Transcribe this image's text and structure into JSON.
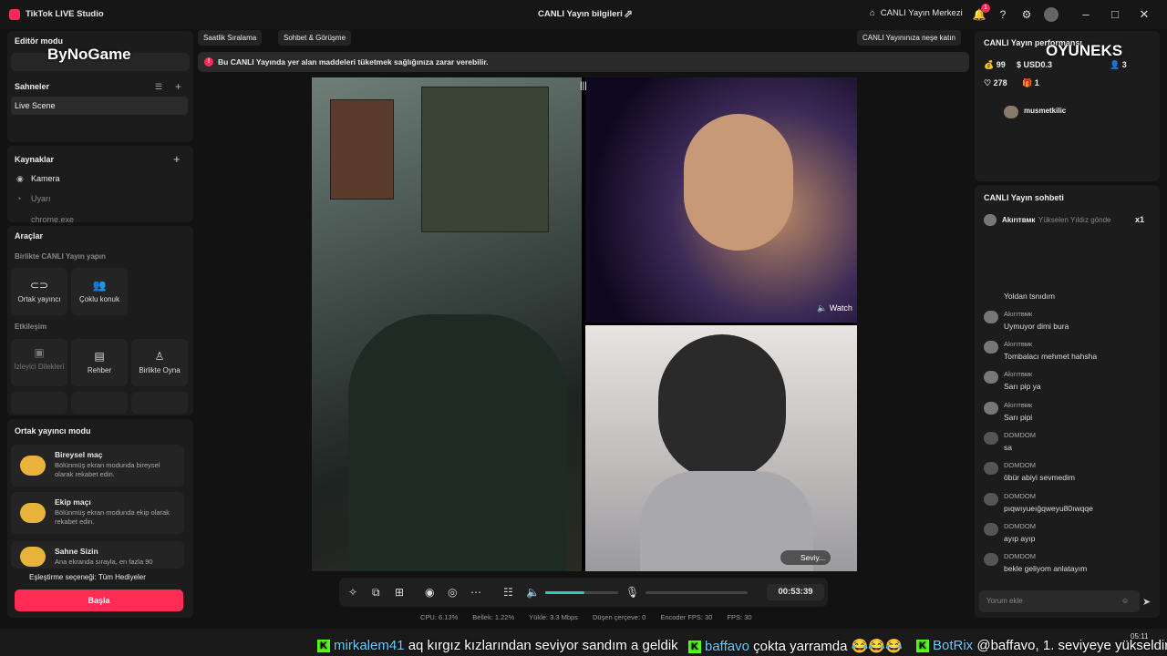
{
  "titlebar": {
    "app_title": "TikTok LIVE Studio",
    "center_title": "CANLI Yayın bilgileri",
    "live_center": "CANLI Yayın Merkezi",
    "notif_count": "1"
  },
  "left": {
    "editor_mode": "Editör modu",
    "watermark": "ByNoGame",
    "scenes_title": "Sahneler",
    "scene_item": "Live Scene",
    "sources_title": "Kaynaklar",
    "sources": [
      "Kamera",
      "Uyarı",
      "chrome.exe"
    ],
    "tools_title": "Araçlar",
    "tools_sub": "Birlikte CANLI Yayın yapın",
    "tool_cards": [
      "Ortak yayıncı",
      "Çoklu konuk"
    ],
    "engagement_title": "Etkileşim",
    "engagement_cards": [
      "İzleyici Dilekleri",
      "Rehber",
      "Birlikte Oyna"
    ],
    "cohost_title": "Ortak yayıncı modu",
    "modes": [
      {
        "title": "Bireysel maç",
        "desc": "Bölünmüş ekran modunda bireysel olarak rekabet edin."
      },
      {
        "title": "Ekip maçı",
        "desc": "Bölünmüş ekran modunda ekip olarak rekabet edin."
      },
      {
        "title": "Sahne Sizin",
        "desc": "Ana ekranda sırayla, en fazla 90"
      }
    ],
    "match_option": "Eşleştirme seçeneği: Tüm Hediyeler",
    "start_button": "Başla"
  },
  "top_chips": {
    "hourly": "Saatlik Sıralama",
    "chat": "Sohbet & Görüşme",
    "join": "CANLI Yayınınıza neşe katın"
  },
  "warning": "Bu CANLI Yayında yer alan maddeleri tüketmek sağlığınıza zarar verebilir.",
  "video": {
    "watch_label": "Watch",
    "guest_label": "Seviy..."
  },
  "controls": {
    "timer": "00:53:39",
    "volume_level": 0.54
  },
  "stats": {
    "cpu": "CPU: 6.13%",
    "memory": "Bellek: 1.22%",
    "upload": "Yükle: 3.3 Mbps",
    "dropped": "Düşen çerçeve: 0",
    "encoder_fps": "Encoder FPS: 30",
    "fps": "FPS: 30"
  },
  "right": {
    "perf_title": "CANLI Yayın performansı",
    "coins": "99",
    "usd": "USD0.3",
    "viewers": "3",
    "likes": "278",
    "gifts": "1",
    "brand_watermark": "OYUNEKS",
    "top_viewer": "musmetkilic",
    "chat_title": "CANLI Yayın sohbeti",
    "gift_line": {
      "name": "Akırıтвмк",
      "text": "Yükselen Yıldız gönde",
      "count": "x1"
    },
    "messages": [
      {
        "name": "",
        "text": "Yoldan tsnıdım"
      },
      {
        "name": "Akırıтвмк",
        "text": "Uymuyor dimi bura"
      },
      {
        "name": "Akırıтвмк",
        "text": "Tombalacı mehmet hahsha"
      },
      {
        "name": "Akırıтвмк",
        "text": "Sarı pip ya"
      },
      {
        "name": "Akırıтвмк",
        "text": "Sarı pipi"
      },
      {
        "name": "DOMDOM",
        "text": "sa"
      },
      {
        "name": "DOMDOM",
        "text": "öbür abiyi sevmedim"
      },
      {
        "name": "DOMDOM",
        "text": "pıqwıyueığqweyu80ıwqqe"
      },
      {
        "name": "DOMDOM",
        "text": "ayıp ayıp"
      },
      {
        "name": "DOMDOM",
        "text": "bekle geliyom anlatayım"
      }
    ],
    "comment_placeholder": "Yorum ekle"
  },
  "overlay_chat": {
    "user1": "mirkalem41",
    "msg1": "aq kırgız kızlarından seviyor sandım a geldik",
    "user2": "baffavo",
    "msg2": "çokta yarramda 😂😂😂",
    "user3": "BotRix",
    "msg3": "@baffavo, 1. seviyeye yükseldin"
  },
  "taskbar": {
    "time": "05:11"
  }
}
